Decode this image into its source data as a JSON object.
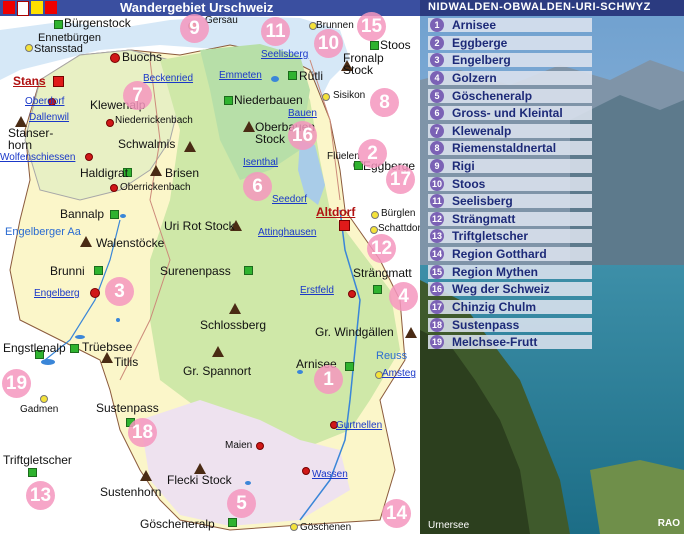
{
  "map": {
    "title": "Wandergebiet Urschweiz",
    "places": [
      {
        "id": "buergenstock",
        "label": "Bürgenstock",
        "style": "big"
      },
      {
        "id": "ennetbuergen",
        "label": "Ennetbürgen"
      },
      {
        "id": "stansstad",
        "label": "Stansstad"
      },
      {
        "id": "gersau",
        "label": "Gersau"
      },
      {
        "id": "brunnen",
        "label": "Brunnen"
      },
      {
        "id": "stoos",
        "label": "Stoos",
        "style": "big"
      },
      {
        "id": "fronalp",
        "label": "Fronalp Stock",
        "style": "big"
      },
      {
        "id": "buochs",
        "label": "Buochs",
        "style": "big"
      },
      {
        "id": "seelisberg",
        "label": "Seelisberg",
        "style": "link"
      },
      {
        "id": "ruetli",
        "label": "Rütli",
        "style": "big"
      },
      {
        "id": "stans",
        "label": "Stans",
        "style": "red"
      },
      {
        "id": "beckenried",
        "label": "Beckenried",
        "style": "link"
      },
      {
        "id": "emmeten",
        "label": "Emmeten",
        "style": "link"
      },
      {
        "id": "sisikon",
        "label": "Sisikon"
      },
      {
        "id": "oberdorf",
        "label": "Oberdorf",
        "style": "link"
      },
      {
        "id": "klewenalp",
        "label": "Klewenalp",
        "style": "big"
      },
      {
        "id": "niederbauen",
        "label": "Niederbauen",
        "style": "big"
      },
      {
        "id": "dallenwil",
        "label": "Dallenwil",
        "style": "link"
      },
      {
        "id": "niederrickenbach",
        "label": "Niederrickenbach"
      },
      {
        "id": "oberbauen",
        "label": "Oberbauen Stock",
        "style": "big"
      },
      {
        "id": "bauen",
        "label": "Bauen",
        "style": "link"
      },
      {
        "id": "stanserhorn",
        "label": "Stanser-horn",
        "style": "big"
      },
      {
        "id": "schwalmis",
        "label": "Schwalmis",
        "style": "big"
      },
      {
        "id": "wolfenschiessen",
        "label": "Wolfenschiessen",
        "style": "link"
      },
      {
        "id": "isenthal",
        "label": "Isenthal",
        "style": "link"
      },
      {
        "id": "flueelen",
        "label": "Flüelen"
      },
      {
        "id": "eggberge",
        "label": "Eggberge",
        "style": "big"
      },
      {
        "id": "haldigrat",
        "label": "Haldigrat",
        "style": "big"
      },
      {
        "id": "brisen",
        "label": "Brisen",
        "style": "big"
      },
      {
        "id": "oberrickenbach",
        "label": "Oberrickenbach"
      },
      {
        "id": "seedorf",
        "label": "Seedorf",
        "style": "link"
      },
      {
        "id": "altdorf",
        "label": "Altdorf",
        "style": "red"
      },
      {
        "id": "buerglen",
        "label": "Bürglen"
      },
      {
        "id": "bannalp",
        "label": "Bannalp",
        "style": "big"
      },
      {
        "id": "urirotstock",
        "label": "Uri Rot Stock",
        "style": "big"
      },
      {
        "id": "schattdorf",
        "label": "Schattdorf"
      },
      {
        "id": "attinghausen",
        "label": "Attinghausen",
        "style": "link"
      },
      {
        "id": "engelbergeraa",
        "label": "Engelberger Aa",
        "style": "lake"
      },
      {
        "id": "walenstoecke",
        "label": "Walenstöcke",
        "style": "big"
      },
      {
        "id": "brunni",
        "label": "Brunni",
        "style": "big"
      },
      {
        "id": "surenenpass",
        "label": "Surenenpass",
        "style": "big"
      },
      {
        "id": "straengmatt",
        "label": "Strängmatt",
        "style": "big"
      },
      {
        "id": "engelberg",
        "label": "Engelberg",
        "style": "link"
      },
      {
        "id": "erstfeld",
        "label": "Erstfeld",
        "style": "link"
      },
      {
        "id": "schlossberg",
        "label": "Schlossberg",
        "style": "big"
      },
      {
        "id": "grwindgaellen",
        "label": "Gr. Windgällen",
        "style": "big"
      },
      {
        "id": "engstlenalp",
        "label": "Engstlenalp",
        "style": "big"
      },
      {
        "id": "trueebsee",
        "label": "Trüebsee",
        "style": "big"
      },
      {
        "id": "titlis",
        "label": "Titlis",
        "style": "big"
      },
      {
        "id": "reuss",
        "label": "Reuss",
        "style": "lake"
      },
      {
        "id": "grspannort",
        "label": "Gr. Spannort",
        "style": "big"
      },
      {
        "id": "arnisee",
        "label": "Arnisee",
        "style": "big"
      },
      {
        "id": "amsteg",
        "label": "Amsteg",
        "style": "link"
      },
      {
        "id": "gadmen",
        "label": "Gadmen"
      },
      {
        "id": "sustenpass",
        "label": "Sustenpass",
        "style": "big"
      },
      {
        "id": "gurtnellen",
        "label": "Gurtnellen",
        "style": "link"
      },
      {
        "id": "maien",
        "label": "Maien"
      },
      {
        "id": "triftgletscher",
        "label": "Triftgletscher",
        "style": "big"
      },
      {
        "id": "wassen",
        "label": "Wassen",
        "style": "link"
      },
      {
        "id": "sustenhorn",
        "label": "Sustenhorn",
        "style": "big"
      },
      {
        "id": "fleckistock",
        "label": "Flecki Stock",
        "style": "big"
      },
      {
        "id": "goescheneralp",
        "label": "Göscheneralp",
        "style": "big"
      },
      {
        "id": "goeschenen",
        "label": "Göschenen"
      }
    ],
    "bubbles": [
      "1",
      "2",
      "3",
      "4",
      "5",
      "6",
      "7",
      "8",
      "9",
      "10",
      "11",
      "12",
      "13",
      "14",
      "15",
      "16",
      "17",
      "18",
      "19"
    ]
  },
  "panel": {
    "region_title": "NIDWALDEN-OBWALDEN-URI-SCHWYZ",
    "routes": [
      {
        "num": "1",
        "name": "Arnisee"
      },
      {
        "num": "2",
        "name": "Eggberge"
      },
      {
        "num": "3",
        "name": "Engelberg"
      },
      {
        "num": "4",
        "name": "Golzern"
      },
      {
        "num": "5",
        "name": "Göscheneralp"
      },
      {
        "num": "6",
        "name": "Gross- und Kleintal"
      },
      {
        "num": "7",
        "name": "Klewenalp"
      },
      {
        "num": "8",
        "name": "Riemenstaldnertal"
      },
      {
        "num": "9",
        "name": "Rigi"
      },
      {
        "num": "10",
        "name": "Stoos"
      },
      {
        "num": "11",
        "name": "Seelisberg"
      },
      {
        "num": "12",
        "name": "Strängmatt"
      },
      {
        "num": "13",
        "name": "Triftgletscher"
      },
      {
        "num": "14",
        "name": "Region Gotthard"
      },
      {
        "num": "15",
        "name": "Region Mythen"
      },
      {
        "num": "16",
        "name": "Weg der Schweiz"
      },
      {
        "num": "17",
        "name": "Chinzig Chulm"
      },
      {
        "num": "18",
        "name": "Sustenpass"
      },
      {
        "num": "19",
        "name": "Melchsee-Frutt"
      }
    ],
    "photo_caption": "Urnersee",
    "credit": "RAO"
  }
}
